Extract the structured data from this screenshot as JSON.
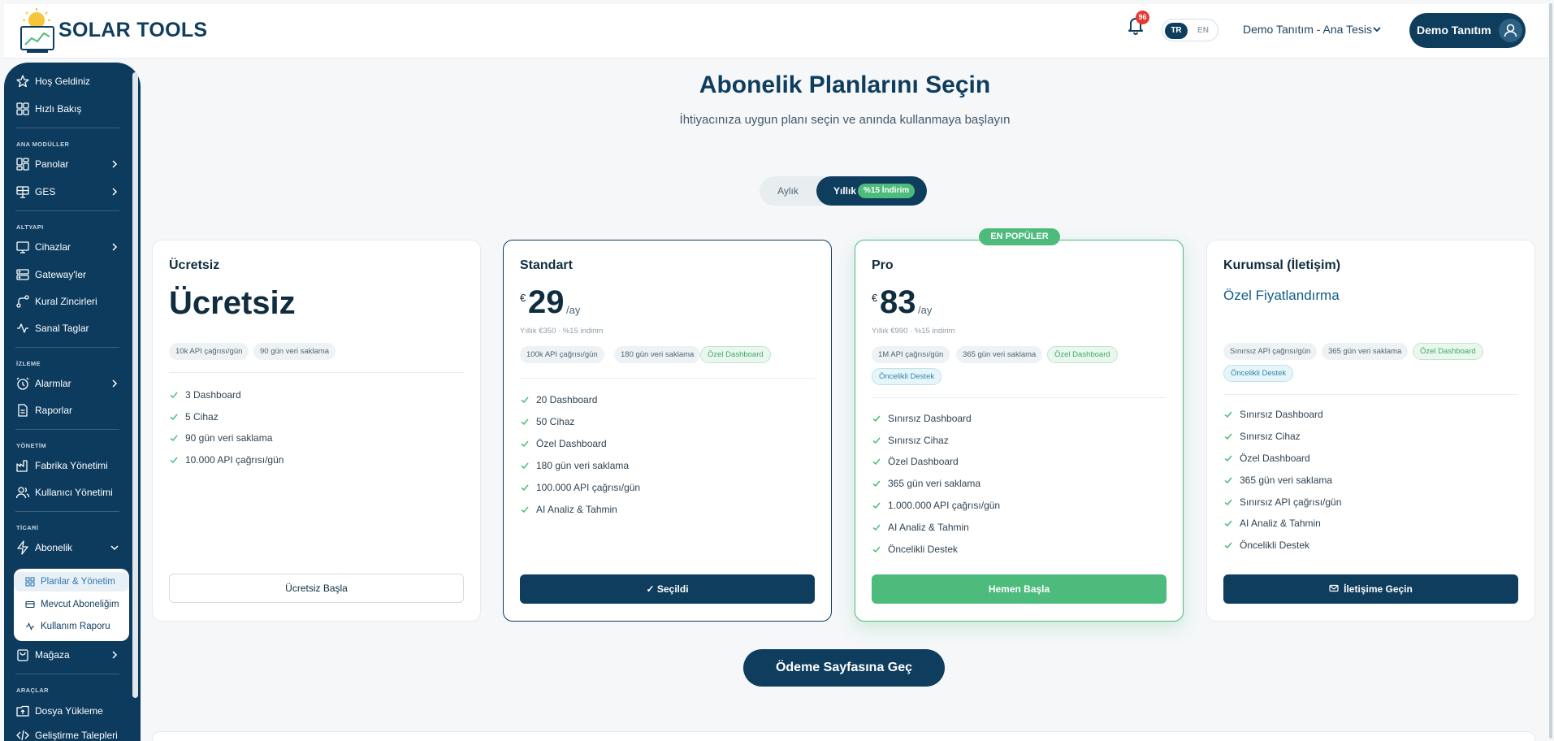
{
  "header": {
    "brand": "SOLAR TOOLS",
    "notification_count": "96",
    "lang_tr": "TR",
    "lang_en": "EN",
    "facility": "Demo Tanıtım - Ana Tesis",
    "user_name": "Demo Tanıtım"
  },
  "sidebar": {
    "welcome": "Hoş Geldiniz",
    "quick": "Hızlı Bakış",
    "sec_main": "ANA MODÜLLER",
    "panels": "Panolar",
    "ges": "GES",
    "sec_infra": "ALTYAPI",
    "devices": "Cihazlar",
    "gateways": "Gateway'ler",
    "rules": "Kural Zincirleri",
    "virtual": "Sanal Taglar",
    "sec_monitor": "İZLEME",
    "alarms": "Alarmlar",
    "reports": "Raporlar",
    "sec_manage": "YÖNETİM",
    "factory": "Fabrika Yönetimi",
    "users": "Kullanıcı Yönetimi",
    "sec_commerce": "TİCARİ",
    "subscription": "Abonelik",
    "sub_plans": "Planlar & Yönetim",
    "sub_current": "Mevcut Aboneliğim",
    "sub_usage": "Kullanım Raporu",
    "store": "Mağaza",
    "sec_tools": "ARAÇLAR",
    "upload": "Dosya Yükleme",
    "dev_requests": "Geliştirme Talepleri"
  },
  "main": {
    "title": "Abonelik Planlarını Seçin",
    "subtitle": "İhtiyacınıza uygun planı seçin ve anında kullanmaya başlayın",
    "billing_monthly": "Aylık",
    "billing_yearly": "Yıllık",
    "billing_discount": "%15 İndirim",
    "popular_badge": "EN POPÜLER",
    "pay_button": "Ödeme Sayfasına Geç"
  },
  "plans": {
    "free": {
      "name": "Ücretsiz",
      "price_text": "Ücretsiz",
      "chips": [
        "10k API çağrısı/gün",
        "90 gün veri saklama"
      ],
      "features": [
        "3 Dashboard",
        "5 Cihaz",
        "90 gün veri saklama",
        "10.000 API çağrısı/gün"
      ],
      "button": "Ücretsiz Başla"
    },
    "standard": {
      "name": "Standart",
      "currency": "€",
      "amount": "29",
      "per": "/ay",
      "yearly_note": "Yıllık €350 · %15 indirim",
      "chips": [
        "100k API çağrısı/gün",
        "180 gün veri saklama",
        "Özel Dashboard"
      ],
      "features": [
        "20 Dashboard",
        "50 Cihaz",
        "Özel Dashboard",
        "180 gün veri saklama",
        "100.000 API çağrısı/gün",
        "AI Analiz & Tahmin"
      ],
      "button": "✓ Seçildi"
    },
    "pro": {
      "name": "Pro",
      "currency": "€",
      "amount": "83",
      "per": "/ay",
      "yearly_note": "Yıllık €990 · %15 indirim",
      "chips": [
        "1M API çağrısı/gün",
        "365 gün veri saklama",
        "Özel Dashboard",
        "Öncelikli Destek"
      ],
      "features": [
        "Sınırsız Dashboard",
        "Sınırsız Cihaz",
        "Özel Dashboard",
        "365 gün veri saklama",
        "1.000.000 API çağrısı/gün",
        "AI Analiz & Tahmin",
        "Öncelikli Destek"
      ],
      "button": "Hemen Başla"
    },
    "enterprise": {
      "name": "Kurumsal (İletişim)",
      "price_text": "Özel Fiyatlandırma",
      "chips": [
        "Sınırsız API çağrısı/gün",
        "365 gün veri saklama",
        "Özel Dashboard",
        "Öncelikli Destek"
      ],
      "features": [
        "Sınırsız Dashboard",
        "Sınırsız Cihaz",
        "Özel Dashboard",
        "365 gün veri saklama",
        "Sınırsız API çağrısı/gün",
        "AI Analiz & Tahmin",
        "Öncelikli Destek"
      ],
      "button": "İletişime Geçin"
    }
  },
  "colors": {
    "navy": "#0f3d5e",
    "green": "#4dbb7b",
    "badge_red": "#e53935"
  }
}
